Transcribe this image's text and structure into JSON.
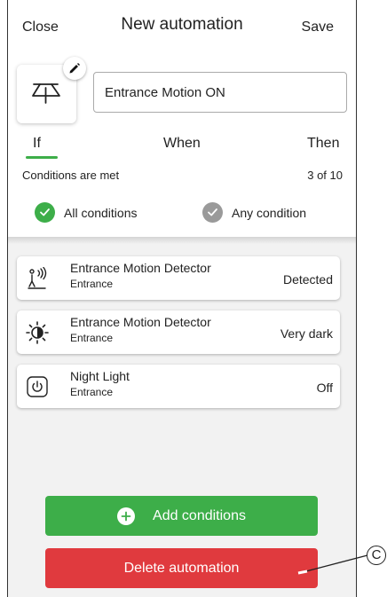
{
  "header": {
    "close_label": "Close",
    "title": "New automation",
    "save_label": "Save"
  },
  "automation": {
    "name_value": "Entrance Motion ON",
    "icon": "automation-lamp-icon"
  },
  "tabs": [
    {
      "label": "If",
      "active": true
    },
    {
      "label": "When",
      "active": false
    },
    {
      "label": "Then",
      "active": false
    }
  ],
  "conditions": {
    "heading": "Conditions are met",
    "count": "3 of 10",
    "options": [
      {
        "label": "All conditions",
        "selected": true
      },
      {
        "label": "Any condition",
        "selected": false
      }
    ],
    "items": [
      {
        "title": "Entrance Motion Detector",
        "subtitle": "Entrance",
        "state": "Detected",
        "icon": "motion-sensor-icon"
      },
      {
        "title": "Entrance Motion Detector",
        "subtitle": "Entrance",
        "state": "Very dark",
        "icon": "brightness-icon"
      },
      {
        "title": "Night Light",
        "subtitle": "Entrance",
        "state": "Off",
        "icon": "power-icon"
      }
    ]
  },
  "actions": {
    "add_label": "Add conditions",
    "delete_label": "Delete automation"
  },
  "callout": {
    "label": "C"
  },
  "colors": {
    "accent_green": "#3dae49",
    "danger_red": "#e03a3e",
    "unselected_gray": "#9a9a9a"
  }
}
